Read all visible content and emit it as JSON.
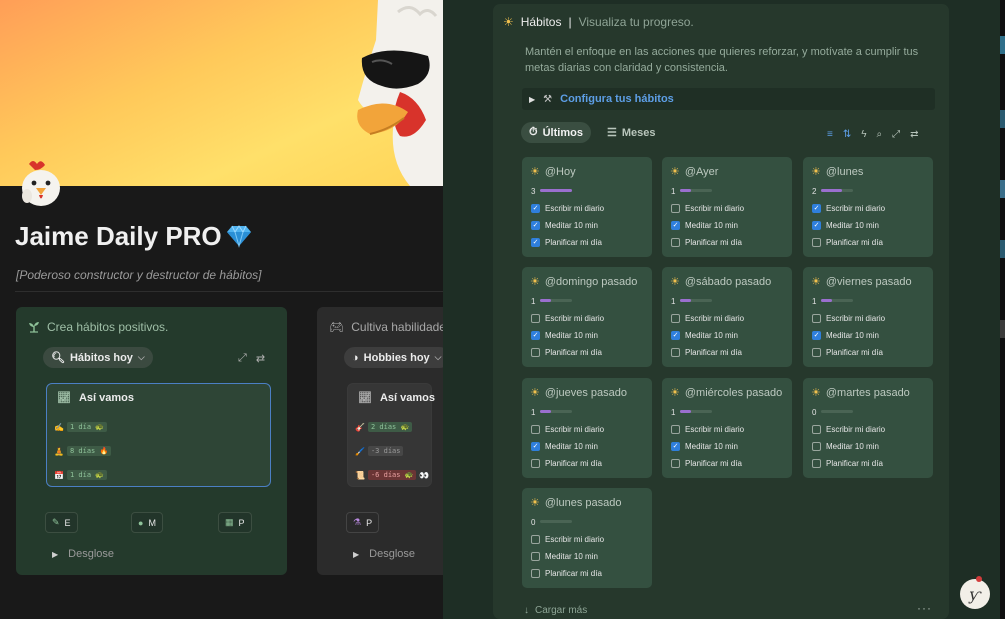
{
  "page": {
    "title": "Jaime Daily PRO",
    "title_icon": "gem-icon",
    "subtitle": "[Poderoso constructor y destructor de hábitos]"
  },
  "left_callouts": [
    {
      "header_text": "Crea hábitos positivos.",
      "header_icon": "sprout-icon",
      "view_pill": "Hábitos hoy",
      "card_title": "Así vamos",
      "rows": [
        {
          "emoji": "✍️",
          "badge": "1 día 🐢"
        },
        {
          "emoji": "🧘",
          "badge": "8 días 🔥"
        },
        {
          "emoji": "📅",
          "badge": "1 día 🐢"
        }
      ],
      "buttons": [
        "E",
        "M",
        "P"
      ],
      "toggle": "Desglose"
    },
    {
      "header_text": "Cultiva habilidades y",
      "header_icon": "gamepad-icon",
      "view_pill": "Hobbies hoy",
      "card_title": "Así vamos",
      "rows": [
        {
          "emoji": "🎸",
          "badge": "2 días 🐢"
        },
        {
          "emoji": "🖌️",
          "badge": "-3 días"
        },
        {
          "emoji": "📜",
          "badge": "-6 días 🐢",
          "extra": "👀"
        }
      ],
      "buttons": [
        "P"
      ],
      "toggle": "Desglose"
    }
  ],
  "panel": {
    "title": "Hábitos",
    "separator": "|",
    "subtitle": "Visualiza tu progreso.",
    "description": "Mantén el enfoque en las acciones que quieres reforzar, y motívate a cumplir tus metas diarias con claridad y consistencia.",
    "configure_label": "Configura tus hábitos",
    "tabs": [
      {
        "label": "Últimos",
        "active": true
      },
      {
        "label": "Meses",
        "active": false
      }
    ],
    "load_more": "Cargar más",
    "more": "···"
  },
  "habit_names": [
    "Escribir mi diario",
    "Meditar 10 min",
    "Planificar mi día"
  ],
  "cards": [
    {
      "title": "@Hoy",
      "count": "3",
      "progress": 1.0,
      "checks": [
        true,
        true,
        true
      ]
    },
    {
      "title": "@Ayer",
      "count": "1",
      "progress": 0.33,
      "checks": [
        false,
        true,
        false
      ]
    },
    {
      "title": "@lunes",
      "count": "2",
      "progress": 0.67,
      "checks": [
        true,
        true,
        false
      ]
    },
    {
      "title": "@domingo pasado",
      "count": "1",
      "progress": 0.33,
      "checks": [
        false,
        true,
        false
      ]
    },
    {
      "title": "@sábado pasado",
      "count": "1",
      "progress": 0.33,
      "checks": [
        false,
        true,
        false
      ]
    },
    {
      "title": "@viernes pasado",
      "count": "1",
      "progress": 0.33,
      "checks": [
        false,
        true,
        false
      ]
    },
    {
      "title": "@jueves pasado",
      "count": "1",
      "progress": 0.33,
      "checks": [
        false,
        true,
        false
      ]
    },
    {
      "title": "@miércoles pasado",
      "count": "1",
      "progress": 0.33,
      "checks": [
        false,
        true,
        false
      ]
    },
    {
      "title": "@martes pasado",
      "count": "0",
      "progress": 0.0,
      "checks": [
        false,
        false,
        false
      ]
    },
    {
      "title": "@lunes pasado",
      "count": "0",
      "progress": 0.0,
      "checks": [
        false,
        false,
        false
      ]
    }
  ],
  "colors": {
    "accent_blue": "#2f7fdc",
    "progress_purple": "#9a6fcf",
    "panel_green": "#26382c",
    "card_green": "#345040"
  }
}
